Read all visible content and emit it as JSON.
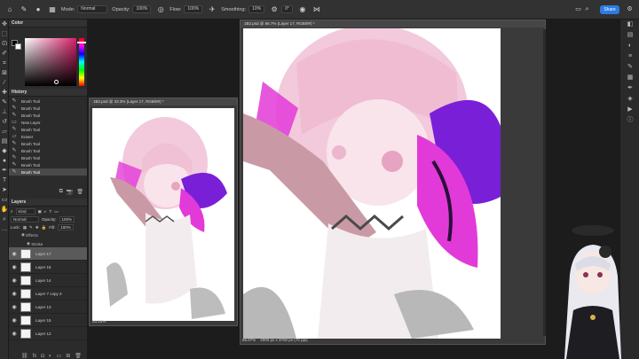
{
  "options_bar": {
    "mode_label": "Mode:",
    "mode_value": "Normal",
    "opacity_label": "Opacity:",
    "opacity_value": "100%",
    "flow_label": "Flow:",
    "flow_value": "100%",
    "smoothing_label": "Smoothing:",
    "smoothing_value": "10%",
    "angle_value": "0°",
    "share_label": "Share"
  },
  "color_panel": {
    "title": "Color",
    "hue_color": "#d8206a"
  },
  "history_panel": {
    "title": "History",
    "items": [
      {
        "label": "Brush Tool",
        "icon": "brush-icon"
      },
      {
        "label": "Brush Tool",
        "icon": "brush-icon"
      },
      {
        "label": "Brush Tool",
        "icon": "brush-icon"
      },
      {
        "label": "New Layer",
        "icon": "layer-icon"
      },
      {
        "label": "Brush Tool",
        "icon": "brush-icon"
      },
      {
        "label": "Eraser",
        "icon": "eraser-icon"
      },
      {
        "label": "Brush Tool",
        "icon": "brush-icon"
      },
      {
        "label": "Brush Tool",
        "icon": "brush-icon"
      },
      {
        "label": "Brush Tool",
        "icon": "brush-icon"
      },
      {
        "label": "Brush Tool",
        "icon": "brush-icon"
      },
      {
        "label": "Brush Tool",
        "icon": "brush-icon"
      }
    ],
    "selected_index": 10
  },
  "layers_panel": {
    "title": "Layers",
    "filter_label": "Kind",
    "blend_mode": "Normal",
    "opacity_label": "Opacity:",
    "opacity_value": "100%",
    "lock_label": "Lock:",
    "fill_label": "Fill:",
    "fill_value": "100%",
    "effects_label": "Effects",
    "stroke_label": "Stroke",
    "layers": [
      {
        "name": "Layer 17",
        "selected": true
      },
      {
        "name": "Layer 16",
        "selected": false
      },
      {
        "name": "Layer 14",
        "selected": false
      },
      {
        "name": "Layer 7 copy 3",
        "selected": false
      },
      {
        "name": "Layer 13",
        "selected": false
      },
      {
        "name": "Layer 15",
        "selected": false
      },
      {
        "name": "Layer 12",
        "selected": false
      }
    ]
  },
  "doc_small": {
    "tab_title": "1B2.psd @ 33.3% (Layer 17, RGB/8#) *",
    "zoom": "33.33%"
  },
  "doc_large": {
    "tab_title": "1B2.psd @ 66.7% (Layer 17, RGB/8#) *",
    "zoom": "66.67%",
    "doc_size": "2000 px x 3700 px (72 ppi)"
  },
  "colors": {
    "wing_purple": "#7a1fd8",
    "wing_magenta": "#e23ad8",
    "hair_pink": "#f3c9dc",
    "skin_mauve": "#c99aa5",
    "share_blue": "#2d7be5"
  }
}
